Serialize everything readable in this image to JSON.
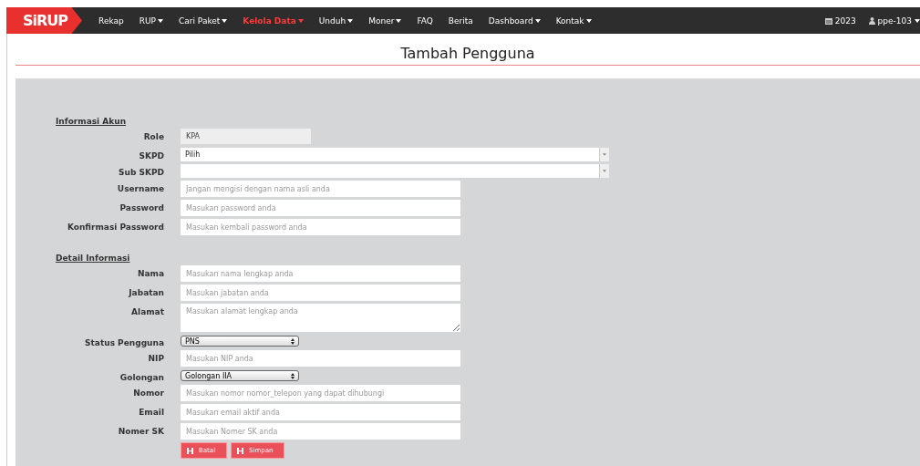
{
  "navbar": {
    "logo": "SiRUP",
    "items": [
      {
        "label": "Rekap",
        "dropdown": false,
        "selected": false
      },
      {
        "label": "RUP",
        "dropdown": true,
        "selected": false
      },
      {
        "label": "Cari Paket",
        "dropdown": true,
        "selected": false
      },
      {
        "label": "Kelola Data",
        "dropdown": true,
        "selected": true
      },
      {
        "label": "Unduh",
        "dropdown": true,
        "selected": false
      },
      {
        "label": "Moner",
        "dropdown": true,
        "selected": false
      },
      {
        "label": "FAQ",
        "dropdown": false,
        "selected": false
      },
      {
        "label": "Berita",
        "dropdown": false,
        "selected": false
      },
      {
        "label": "Dashboard",
        "dropdown": true,
        "selected": false
      },
      {
        "label": "Kontak",
        "dropdown": true,
        "selected": false
      }
    ],
    "year": "2023",
    "user": "ppe-103"
  },
  "page_title": "Tambah Pengguna",
  "sections": [
    {
      "heading": "Informasi Akun",
      "fields": [
        {
          "label": "Role",
          "kind": "readonly",
          "value": "KPA"
        },
        {
          "label": "SKPD",
          "kind": "combo",
          "value": "Pilih"
        },
        {
          "label": "Sub SKPD",
          "kind": "combo"
        },
        {
          "label": "Username",
          "kind": "text",
          "placeholder": "Jangan mengisi dengan nama asli anda"
        },
        {
          "label": "Password",
          "kind": "text",
          "placeholder": "Masukan password anda"
        },
        {
          "label": "Konfirmasi Password",
          "kind": "text",
          "placeholder": "Masukan kembali password anda"
        }
      ]
    },
    {
      "heading": "Detail Informasi",
      "fields": [
        {
          "label": "Nama",
          "kind": "text",
          "placeholder": "Masukan nama lengkap anda"
        },
        {
          "label": "Jabatan",
          "kind": "text",
          "placeholder": "Masukan jabatan anda"
        },
        {
          "label": "Alamat",
          "kind": "textarea",
          "placeholder": "Masukan alamat lengkap anda"
        },
        {
          "label": "Status Pengguna",
          "kind": "select",
          "value": "PNS"
        },
        {
          "label": "NIP",
          "kind": "text",
          "placeholder": "Masukan NIP anda"
        },
        {
          "label": "Golongan",
          "kind": "select",
          "value": "Golongan IIA"
        },
        {
          "label": "Nomor",
          "kind": "text",
          "placeholder": "Masukan nomor nomor_telepon yang dapat dihubungi"
        },
        {
          "label": "Email",
          "kind": "text",
          "placeholder": "Masukan email aktif anda"
        },
        {
          "label": "Nomer SK",
          "kind": "text",
          "placeholder": "Masukan Nomer SK anda"
        }
      ]
    }
  ],
  "buttons": [
    "Batal",
    "Simpan"
  ]
}
